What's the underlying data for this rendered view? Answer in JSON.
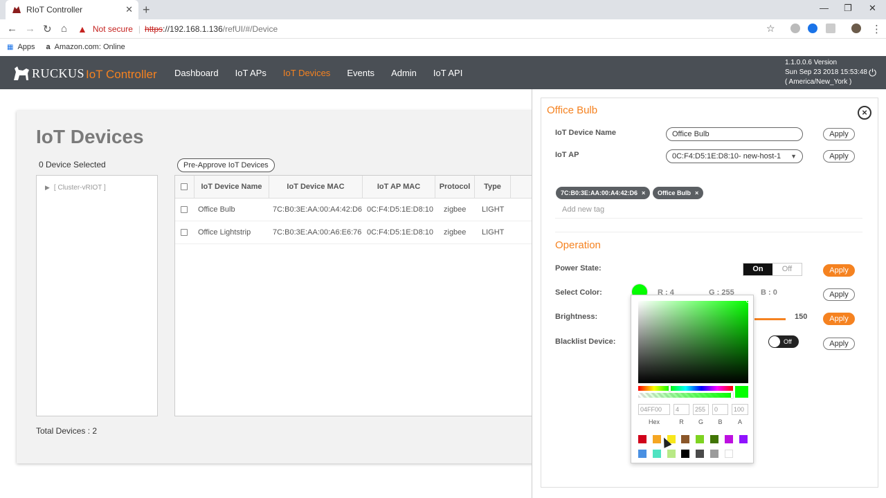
{
  "browser": {
    "tab_title": "RIoT Controller",
    "tab_close": "✕",
    "new_tab": "+",
    "security_label": "Not secure",
    "url_scheme": "https",
    "url_host": "://192.168.1.136",
    "url_path": "/refUI/#/Device",
    "bookmarks": [
      {
        "icon": "apps-icon",
        "label": "Apps"
      },
      {
        "icon": "amazon-icon",
        "label": "Amazon.com: Online"
      }
    ]
  },
  "app": {
    "brand": "RUCKUS",
    "product": "IoT Controller",
    "nav": [
      "Dashboard",
      "IoT APs",
      "IoT Devices",
      "Events",
      "Admin",
      "IoT API"
    ],
    "active_nav": "IoT Devices",
    "version": "1.1.0.0.6 Version",
    "datetime": "Sun Sep 23 2018 15:53:48",
    "timezone": "( America/New_York )",
    "accent_color": "#f58220"
  },
  "devices_page": {
    "title": "IoT Devices",
    "selected_count": "0 Device Selected",
    "pre_approve_label": "Pre-Approve IoT Devices",
    "tree_item": "[ Cluster-vRIOT ]",
    "columns": [
      "IoT Device Name",
      "IoT Device MAC",
      "IoT AP MAC",
      "Protocol",
      "Type"
    ],
    "rows": [
      {
        "name": "Office Bulb",
        "mac": "7C:B0:3E:AA:00:A4:42:D6",
        "ap_mac": "0C:F4:D5:1E:D8:10",
        "protocol": "zigbee",
        "type": "LIGHT"
      },
      {
        "name": "Office Lightstrip",
        "mac": "7C:B0:3E:AA:00:A6:E6:76",
        "ap_mac": "0C:F4:D5:1E:D8:10",
        "protocol": "zigbee",
        "type": "LIGHT"
      }
    ],
    "total": "Total Devices : 2"
  },
  "panel": {
    "title": "Office Bulb",
    "name_label": "IoT Device Name",
    "name_value": "Office Bulb",
    "ap_label": "IoT AP",
    "ap_value": "0C:F4:D5:1E:D8:10- new-host-1",
    "apply_label": "Apply",
    "tags": [
      "7C:B0:3E:AA:00:A4:42:D6",
      "Office Bulb"
    ],
    "tag_remove": "×",
    "add_tag_placeholder": "Add new tag",
    "operation_title": "Operation",
    "power_label": "Power State:",
    "power_on": "On",
    "power_off": "Off",
    "color_label": "Select Color:",
    "r_text": "R : 4",
    "g_text": "G : 255",
    "b_text": "B : 0",
    "brightness_label": "Brightness:",
    "brightness_value": "150",
    "blacklist_label": "Blacklist Device:",
    "blacklist_state": "Off",
    "selected_color": "#04ff00"
  },
  "color_picker": {
    "hex": "04FF00",
    "r": "4",
    "g": "255",
    "b": "0",
    "a": "100",
    "labels": [
      "Hex",
      "R",
      "G",
      "B",
      "A"
    ],
    "swatches": [
      "#d0021b",
      "#f5a623",
      "#f8e71c",
      "#8b572a",
      "#7ed321",
      "#417505",
      "#bd10e0",
      "#9013fe",
      "#4a90e2",
      "#50e3c2",
      "#b8e986",
      "#000000",
      "#4a4a4a",
      "#9b9b9b",
      "#ffffff"
    ]
  }
}
